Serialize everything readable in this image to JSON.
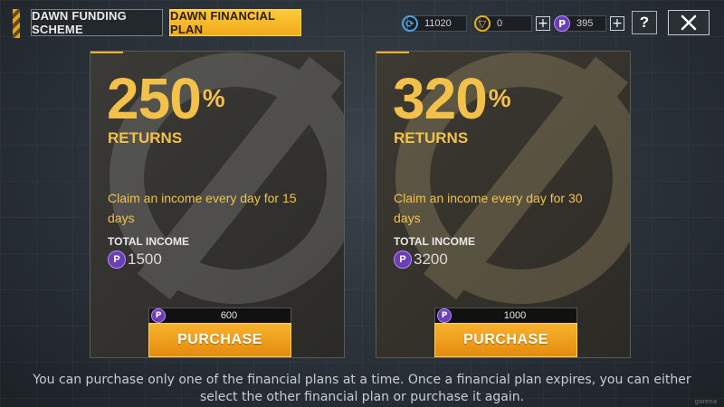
{
  "tabs": [
    {
      "label": "DAWN FUNDING SCHEME",
      "active": false
    },
    {
      "label": "DAWN FINANCIAL PLAN",
      "active": true
    }
  ],
  "currencies": [
    {
      "icon": "refresh-coin-icon",
      "amount": "11020",
      "color": "#4aa3e0"
    },
    {
      "icon": "gold-coin-icon",
      "amount": "0",
      "color": "#e8b020"
    },
    {
      "icon": "purple-coin-icon",
      "amount": "395",
      "color": "#8a5ad8"
    }
  ],
  "help_label": "?",
  "plans": [
    {
      "percent": "250",
      "percent_sign": "%",
      "returns_label": "RETURNS",
      "description": "Claim an income every day for 15 days",
      "total_label": "TOTAL INCOME",
      "total_value": "1500",
      "price": "600",
      "button_label": "PURCHASE"
    },
    {
      "percent": "320",
      "percent_sign": "%",
      "returns_label": "RETURNS",
      "description": "Claim an income every day for 30 days",
      "total_label": "TOTAL INCOME",
      "total_value": "3200",
      "price": "1000",
      "button_label": "PURCHASE"
    }
  ],
  "footer_text": "You can purchase only one of the financial plans at a time. Once a financial plan expires, you can either select the other financial plan or purchase it again.",
  "corner_tag": "garena",
  "colors": {
    "accent": "#f3c14a",
    "tab_active": "#f0a91a",
    "button": "#e58b0e",
    "coin_purple": "#6a3fb5"
  }
}
